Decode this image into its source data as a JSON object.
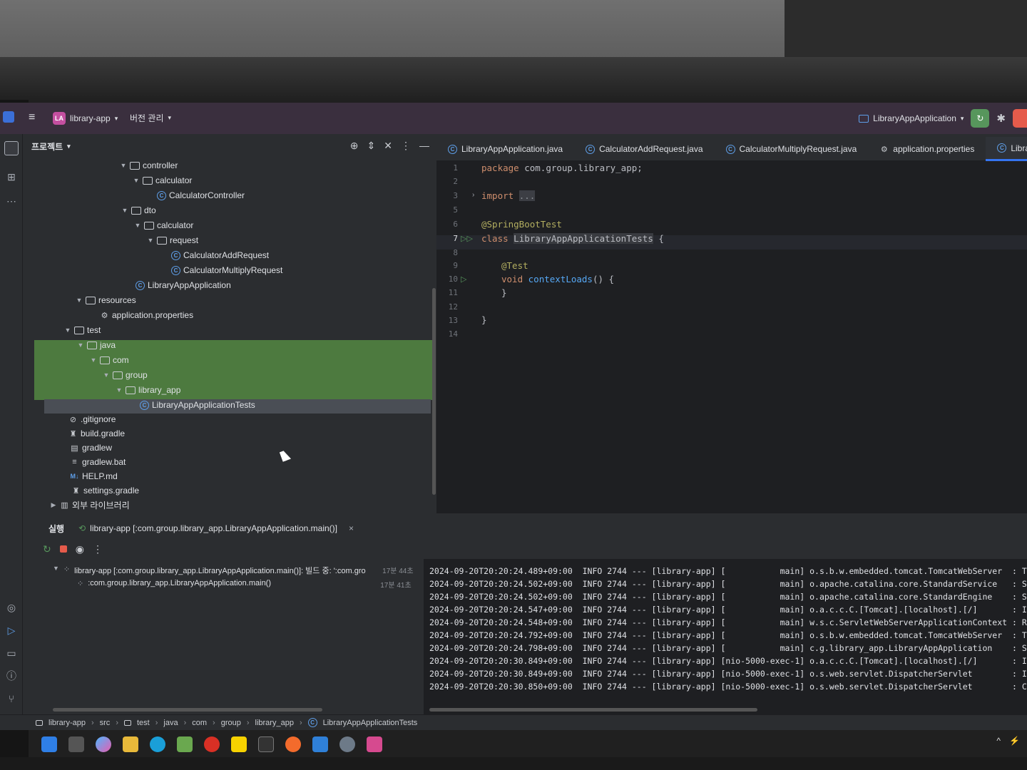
{
  "titlebar": {
    "project_badge": "LA",
    "project_name": "library-app",
    "vcs_label": "버전 관리",
    "run_config": "LibraryAppApplication"
  },
  "project_panel": {
    "title": "프로젝트",
    "tree": [
      {
        "label": "controller",
        "kind": "folder"
      },
      {
        "label": "calculator",
        "kind": "folder"
      },
      {
        "label": "CalculatorController",
        "kind": "class"
      },
      {
        "label": "dto",
        "kind": "folder"
      },
      {
        "label": "calculator",
        "kind": "folder"
      },
      {
        "label": "request",
        "kind": "folder"
      },
      {
        "label": "CalculatorAddRequest",
        "kind": "class"
      },
      {
        "label": "CalculatorMultiplyRequest",
        "kind": "class"
      },
      {
        "label": "LibraryAppApplication",
        "kind": "class"
      },
      {
        "label": "resources",
        "kind": "folder"
      },
      {
        "label": "application.properties",
        "kind": "settings"
      },
      {
        "label": "test",
        "kind": "folder"
      },
      {
        "label": "java",
        "kind": "folder"
      },
      {
        "label": "com",
        "kind": "folder"
      },
      {
        "label": "group",
        "kind": "folder"
      },
      {
        "label": "library_app",
        "kind": "folder"
      },
      {
        "label": "LibraryAppApplicationTests",
        "kind": "class"
      },
      {
        "label": ".gitignore",
        "kind": "file"
      },
      {
        "label": "build.gradle",
        "kind": "file"
      },
      {
        "label": "gradlew",
        "kind": "file"
      },
      {
        "label": "gradlew.bat",
        "kind": "file"
      },
      {
        "label": "HELP.md",
        "kind": "file"
      },
      {
        "label": "settings.gradle",
        "kind": "file"
      },
      {
        "label": "외부 라이브러리",
        "kind": "folder"
      }
    ]
  },
  "editor": {
    "tabs": [
      "LibraryAppApplication.java",
      "CalculatorAddRequest.java",
      "CalculatorMultiplyRequest.java",
      "application.properties",
      "LibraryAppAp"
    ],
    "line_numbers": [
      "1",
      "2",
      "3",
      "5",
      "6",
      "7",
      "8",
      "9",
      "10",
      "11",
      "12",
      "13",
      "14"
    ],
    "code": {
      "l1_kw": "package",
      "l1_rest": " com.group.library_app;",
      "l3_kw": "import",
      "l3_fold": "...",
      "l6": "@SpringBootTest",
      "l7_kw": "class",
      "l7_name": "LibraryAppApplicationTests",
      "l7_rest": " {",
      "l9": "@Test",
      "l10_kw": "void",
      "l10_fn": "contextLoads",
      "l10_rest": "() {",
      "l11": "}",
      "l13": "}"
    }
  },
  "run_panel": {
    "label": "실행",
    "tab": "library-app [:com.group.library_app.LibraryAppApplication.main()]",
    "tree": [
      {
        "label": "library-app [:com.group.library_app.LibraryAppApplication.main()]: 빌드 중: ':com.gro",
        "time": "17분 44초"
      },
      {
        "label": ":com.group.library_app.LibraryAppApplication.main()",
        "time": "17분 41초"
      }
    ],
    "console": [
      "2024-09-20T20:20:24.489+09:00  INFO 2744 --- [library-app] [           main] o.s.b.w.embedded.tomcat.TomcatWebServer  : Tom",
      "2024-09-20T20:20:24.502+09:00  INFO 2744 --- [library-app] [           main] o.apache.catalina.core.StandardService   : Sta",
      "2024-09-20T20:20:24.502+09:00  INFO 2744 --- [library-app] [           main] o.apache.catalina.core.StandardEngine    : Sta",
      "2024-09-20T20:20:24.547+09:00  INFO 2744 --- [library-app] [           main] o.a.c.c.C.[Tomcat].[localhost].[/]       : Ini",
      "2024-09-20T20:20:24.548+09:00  INFO 2744 --- [library-app] [           main] w.s.c.ServletWebServerApplicationContext : Roo",
      "2024-09-20T20:20:24.792+09:00  INFO 2744 --- [library-app] [           main] o.s.b.w.embedded.tomcat.TomcatWebServer  : Tom",
      "2024-09-20T20:20:24.798+09:00  INFO 2744 --- [library-app] [           main] c.g.library_app.LibraryAppApplication    : Sta",
      "2024-09-20T20:20:30.849+09:00  INFO 2744 --- [library-app] [nio-5000-exec-1] o.a.c.c.C.[Tomcat].[localhost].[/]       : Ini",
      "2024-09-20T20:20:30.849+09:00  INFO 2744 --- [library-app] [nio-5000-exec-1] o.s.web.servlet.DispatcherServlet        : Ini",
      "2024-09-20T20:20:30.850+09:00  INFO 2744 --- [library-app] [nio-5000-exec-1] o.s.web.servlet.DispatcherServlet        : Comp"
    ]
  },
  "breadcrumb": [
    "library-app",
    "src",
    "test",
    "java",
    "com",
    "group",
    "library_app",
    "LibraryAppApplicationTests"
  ],
  "colors": {
    "titlebar": "#3a2f3e",
    "selection_green": "#4d7a3f",
    "accent": "#3574f0",
    "keyword": "#cf8e6d",
    "annotation": "#b3ae60",
    "function": "#56a8f5"
  }
}
